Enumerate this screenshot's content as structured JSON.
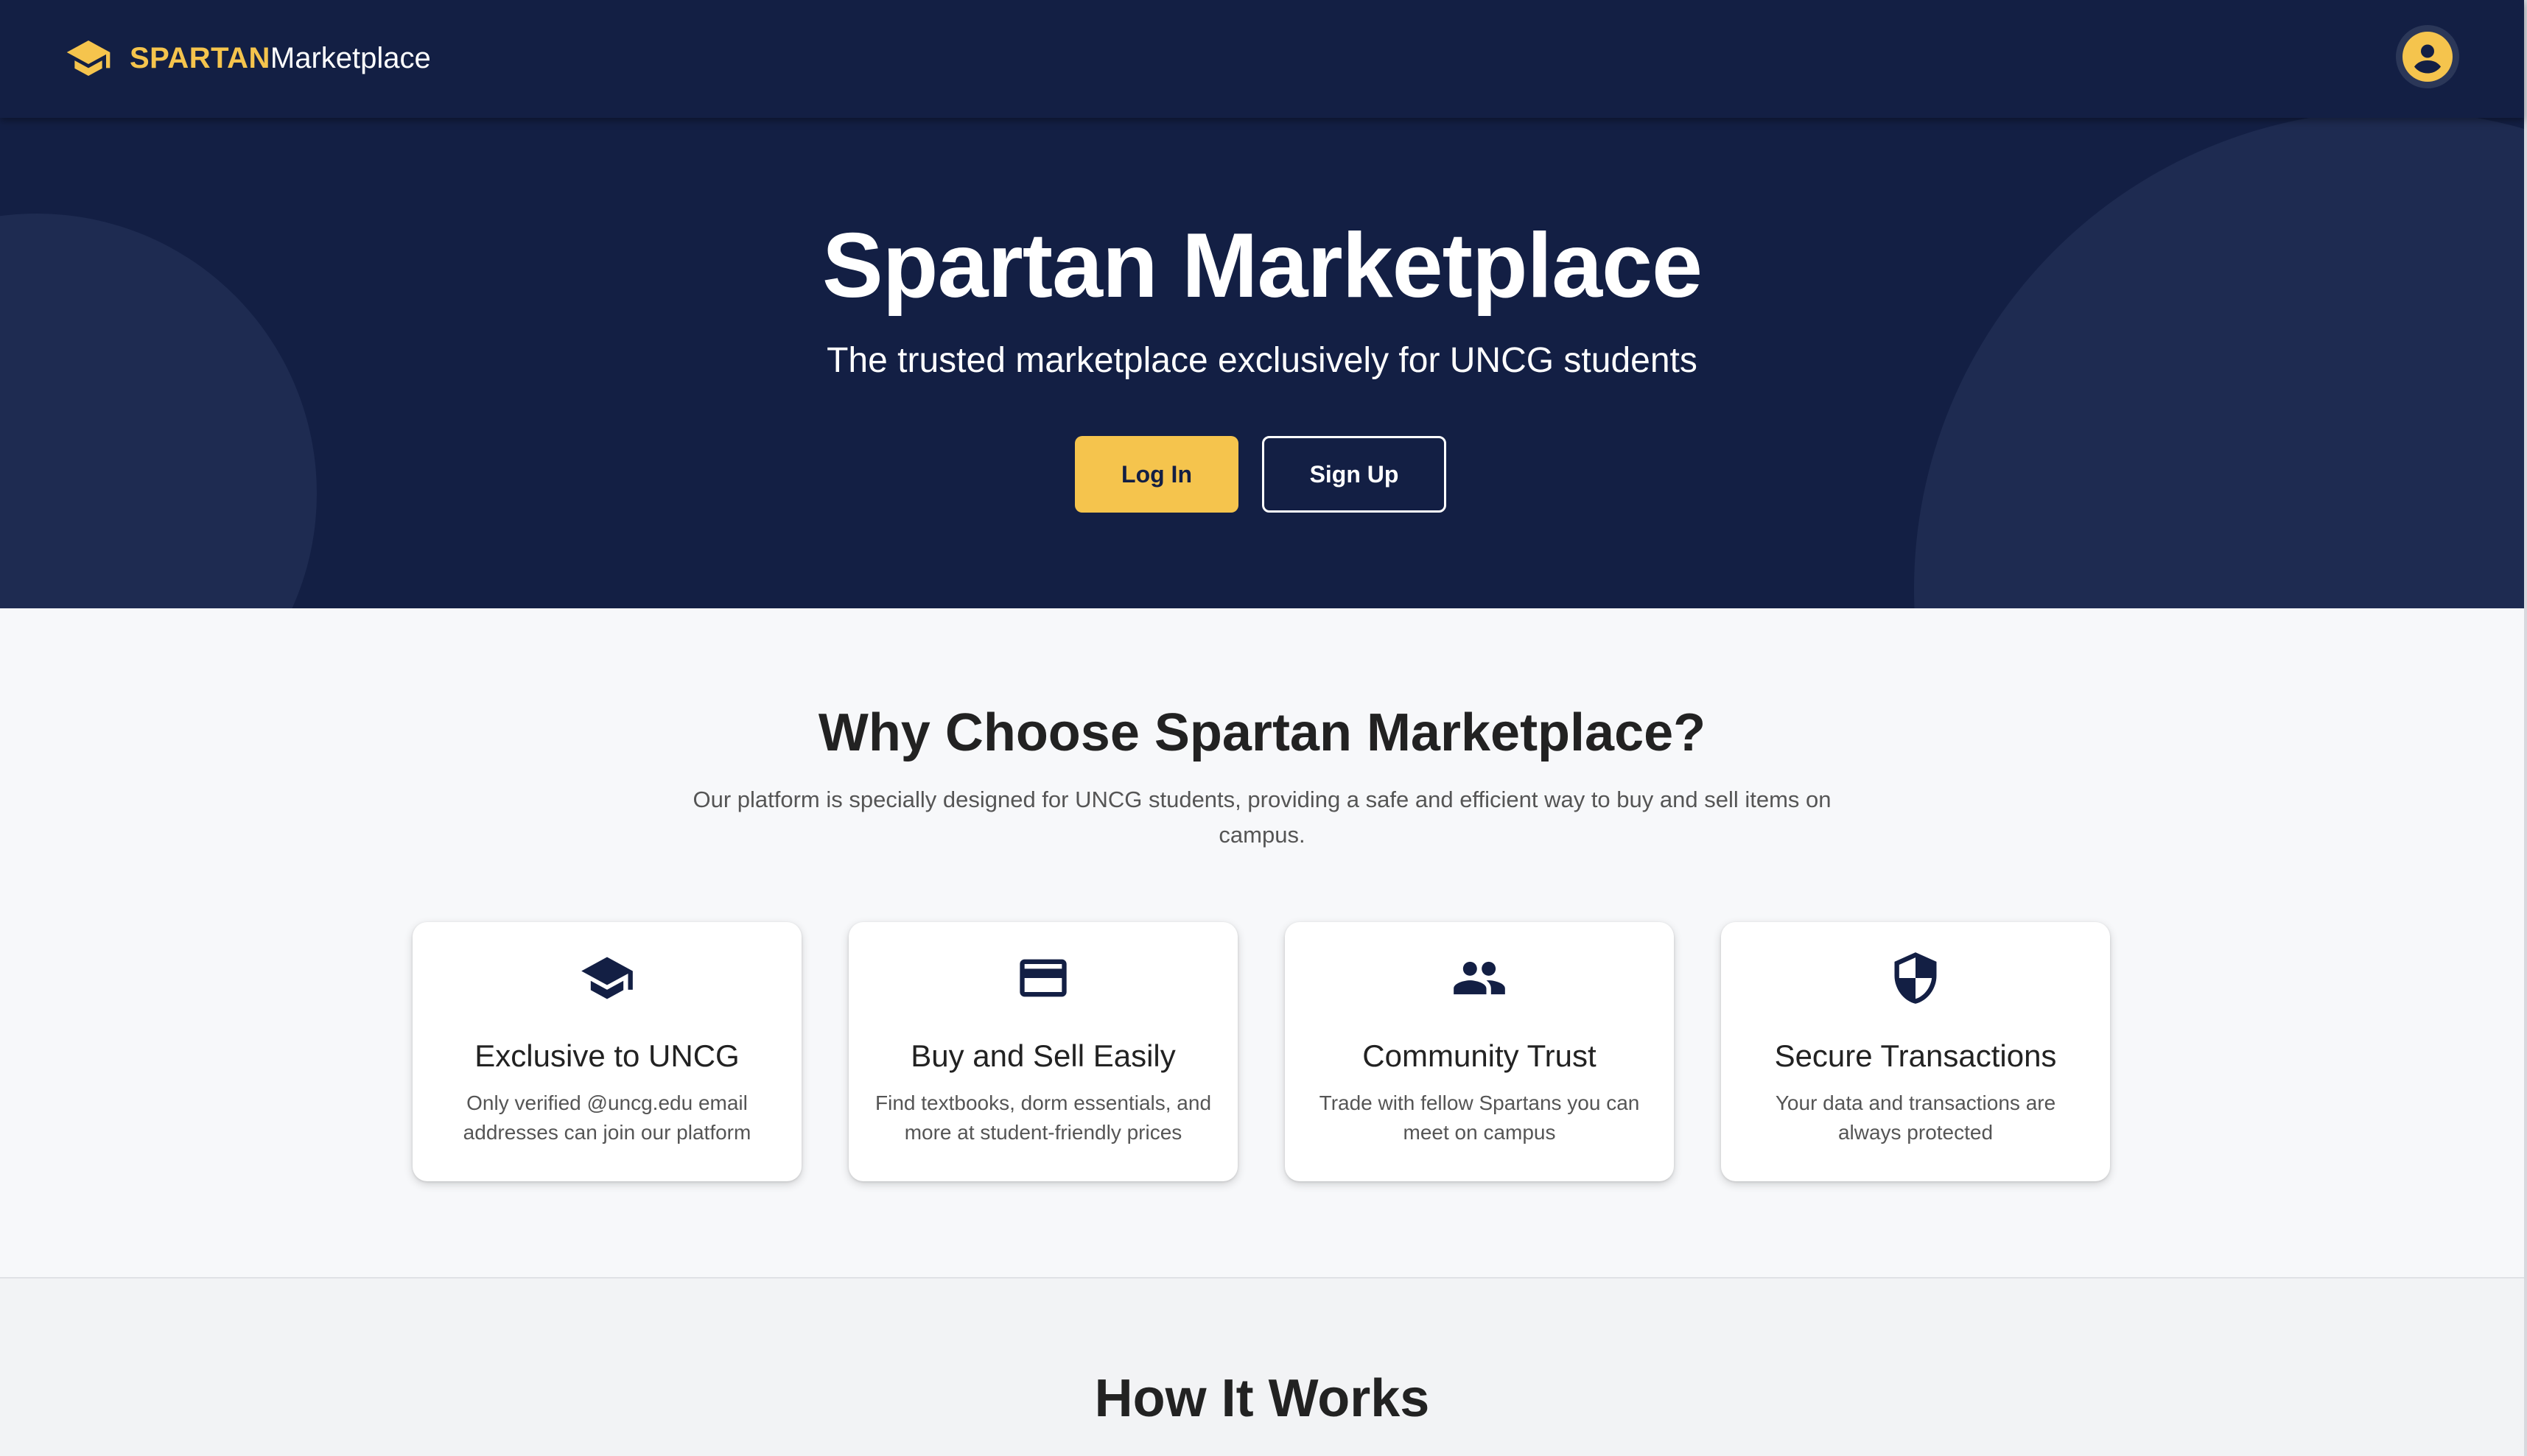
{
  "nav": {
    "brand_primary": "SPARTAN",
    "brand_secondary": "Marketplace",
    "brand_icon": "graduation-cap-icon",
    "avatar_icon": "account-circle-icon"
  },
  "hero": {
    "title": "Spartan Marketplace",
    "subtitle": "The trusted marketplace exclusively for UNCG students",
    "login_label": "Log In",
    "signup_label": "Sign Up"
  },
  "why": {
    "title": "Why Choose Spartan Marketplace?",
    "description": "Our platform is specially designed for UNCG students, providing a safe and efficient way to buy and sell items on campus.",
    "cards": [
      {
        "icon": "graduation-cap-icon",
        "title": "Exclusive to UNCG",
        "text": "Only verified @uncg.edu email addresses can join our platform"
      },
      {
        "icon": "credit-card-icon",
        "title": "Buy and Sell Easily",
        "text": "Find textbooks, dorm essentials, and more at student-friendly prices"
      },
      {
        "icon": "people-icon",
        "title": "Community Trust",
        "text": "Trade with fellow Spartans you can meet on campus"
      },
      {
        "icon": "shield-icon",
        "title": "Secure Transactions",
        "text": "Your data and transactions are always protected"
      }
    ]
  },
  "how": {
    "title": "How It Works"
  },
  "colors": {
    "navy": "#131f44",
    "navy_circle": "#1e2b51",
    "accent_gold": "#f5c44d",
    "page_bg": "#f7f8fa"
  }
}
